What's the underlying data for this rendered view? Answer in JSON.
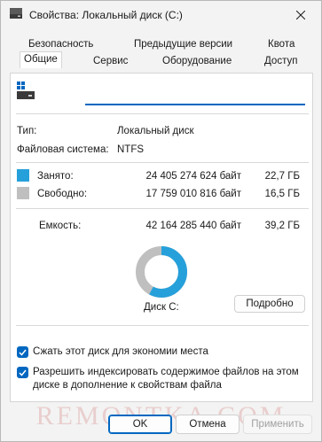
{
  "window": {
    "title": "Свойства: Локальный диск (C:)"
  },
  "tabs": {
    "row1": [
      "Безопасность",
      "Предыдущие версии",
      "Квота"
    ],
    "row2": [
      "Общие",
      "Сервис",
      "Оборудование",
      "Доступ"
    ],
    "active": "Общие"
  },
  "general": {
    "drive_name_value": "",
    "type_label": "Тип:",
    "type_value": "Локальный диск",
    "fs_label": "Файловая система:",
    "fs_value": "NTFS",
    "used_label": "Занято:",
    "used_bytes": "24 405 274 624 байт",
    "used_size": "22,7 ГБ",
    "free_label": "Свободно:",
    "free_bytes": "17 759 010 816 байт",
    "free_size": "16,5 ГБ",
    "capacity_label": "Емкость:",
    "capacity_bytes": "42 164 285 440 байт",
    "capacity_size": "39,2 ГБ",
    "disk_label": "Диск C:",
    "details_button": "Подробно",
    "used_fraction": 0.579,
    "colors": {
      "used": "#26a0da",
      "free": "#bfbfbf",
      "accent": "#0067c0"
    }
  },
  "options": {
    "compress": {
      "label": "Сжать этот диск для экономии места",
      "checked": true
    },
    "index": {
      "label_line1": "Разрешить индексировать содержимое файлов на этом",
      "label_line2": "диске в дополнение к свойствам файла",
      "checked": true
    }
  },
  "buttons": {
    "ok": "OK",
    "cancel": "Отмена",
    "apply": "Применить"
  },
  "watermark": "REMONTKA.COM"
}
